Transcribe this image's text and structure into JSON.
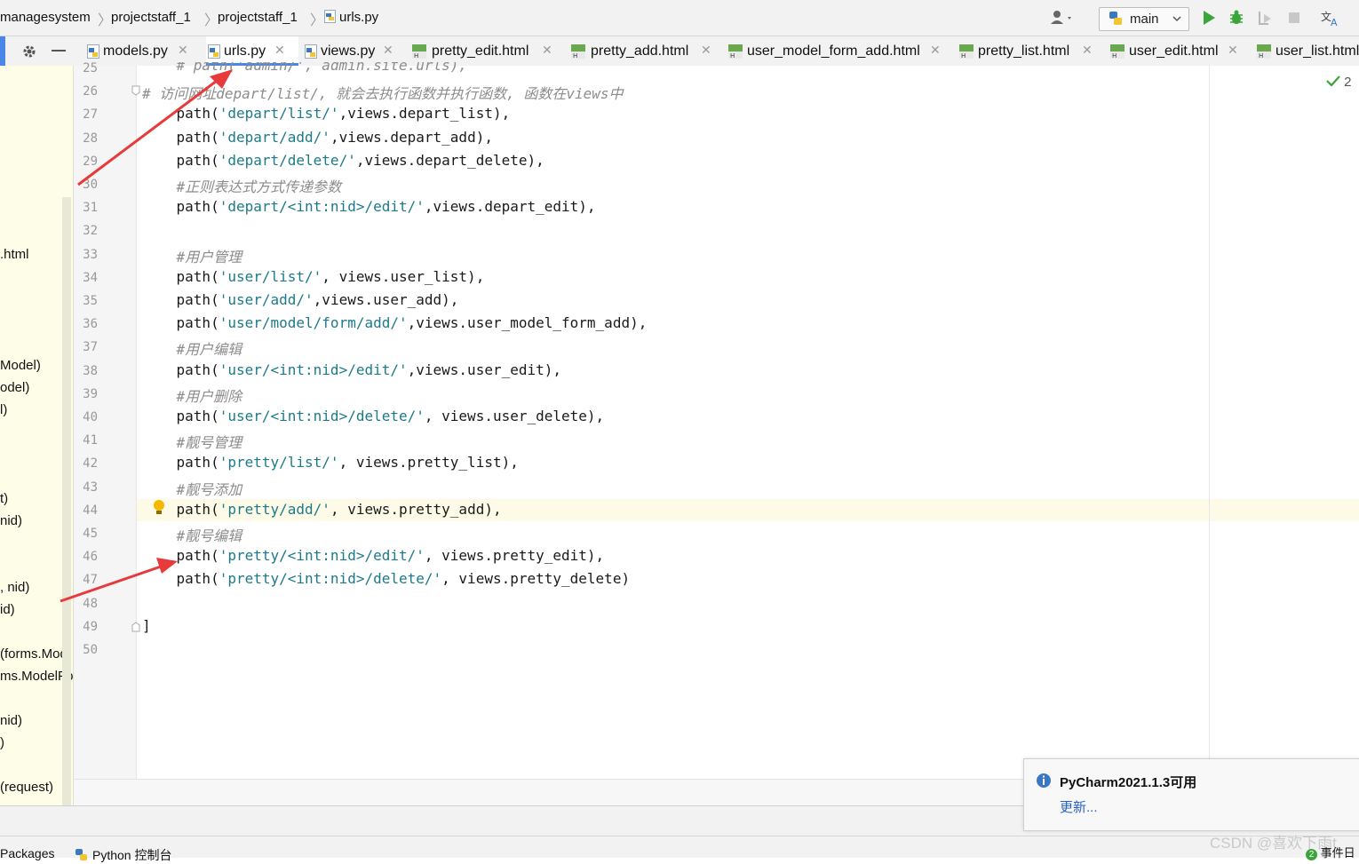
{
  "breadcrumb": [
    "managesystem",
    "projectstaff_1",
    "projectstaff_1",
    "urls.py"
  ],
  "toolbar": {
    "run_config": "main"
  },
  "tabs": [
    {
      "label": "models.py",
      "type": "py"
    },
    {
      "label": "urls.py",
      "type": "py",
      "active": true
    },
    {
      "label": "views.py",
      "type": "py"
    },
    {
      "label": "pretty_edit.html",
      "type": "html"
    },
    {
      "label": "pretty_add.html",
      "type": "html"
    },
    {
      "label": "user_model_form_add.html",
      "type": "html"
    },
    {
      "label": "pretty_list.html",
      "type": "html"
    },
    {
      "label": "user_edit.html",
      "type": "html"
    },
    {
      "label": "user_list.html",
      "type": "html"
    }
  ],
  "project_panel": [
    ".html",
    "Model)",
    "odel)",
    "l)",
    "t)",
    "nid)",
    ", nid)",
    "id)",
    "(forms.Mod",
    "ms.ModelFo",
    "nid)",
    ")",
    "(request)"
  ],
  "editor": {
    "inspection_count": "2",
    "lines": [
      {
        "num": "25",
        "text": "    # path('admin/', admin.site.urls),"
      },
      {
        "num": "26",
        "text": "# 访问网址depart/list/, 就会去执行函数并执行函数, 函数在views中"
      },
      {
        "num": "27",
        "pre": "    path(",
        "str": "'depart/list/'",
        "post": ",views.depart_list),"
      },
      {
        "num": "28",
        "pre": "    path(",
        "str": "'depart/add/'",
        "post": ",views.depart_add),"
      },
      {
        "num": "29",
        "pre": "    path(",
        "str": "'depart/delete/'",
        "post": ",views.depart_delete),"
      },
      {
        "num": "30",
        "text": "    #正则表达式方式传递参数"
      },
      {
        "num": "31",
        "pre": "    path(",
        "str": "'depart/<int:nid>/edit/'",
        "post": ",views.depart_edit),"
      },
      {
        "num": "32",
        "text": ""
      },
      {
        "num": "33",
        "text": "    #用户管理"
      },
      {
        "num": "34",
        "pre": "    path(",
        "str": "'user/list/'",
        "post": ", views.user_list),"
      },
      {
        "num": "35",
        "pre": "    path(",
        "str": "'user/add/'",
        "post": ",views.user_add),"
      },
      {
        "num": "36",
        "pre": "    path(",
        "str": "'user/model/form/add/'",
        "post": ",views.user_model_form_add),"
      },
      {
        "num": "37",
        "text": "    #用户编辑"
      },
      {
        "num": "38",
        "pre": "    path(",
        "str": "'user/<int:nid>/edit/'",
        "post": ",views.user_edit),"
      },
      {
        "num": "39",
        "text": "    #用户删除"
      },
      {
        "num": "40",
        "pre": "    path(",
        "str": "'user/<int:nid>/delete/'",
        "post": ", views.user_delete),"
      },
      {
        "num": "41",
        "text": "    #靓号管理"
      },
      {
        "num": "42",
        "pre": "    path(",
        "str": "'pretty/list/'",
        "post": ", views.pretty_list),"
      },
      {
        "num": "43",
        "text": "    #靓号添加"
      },
      {
        "num": "44",
        "pre": "    path(",
        "str": "'pretty/add/'",
        "post": ", views.pretty_add),"
      },
      {
        "num": "45",
        "text": "    #靓号编辑"
      },
      {
        "num": "46",
        "pre": "    path(",
        "str": "'pretty/<int:nid>/edit/'",
        "post": ", views.pretty_edit),"
      },
      {
        "num": "47",
        "pre": "    path(",
        "str": "'pretty/<int:nid>/delete/'",
        "post": ", views.pretty_delete)"
      },
      {
        "num": "48",
        "text": ""
      },
      {
        "num": "49",
        "text": "]"
      },
      {
        "num": "50",
        "text": ""
      }
    ]
  },
  "bottom_tools": [
    "Packages",
    "Python 控制台"
  ],
  "notification": {
    "title": "PyCharm2021.1.3可用",
    "link": "更新..."
  },
  "watermark": "CSDN @喜欢下雨t",
  "events_label": "事件日",
  "events_count": "2",
  "colors": {
    "accent": "#4a86e8",
    "string": "#1c7a8a",
    "comment": "#8c8c8c",
    "annotation_arrow": "#e8393b"
  }
}
